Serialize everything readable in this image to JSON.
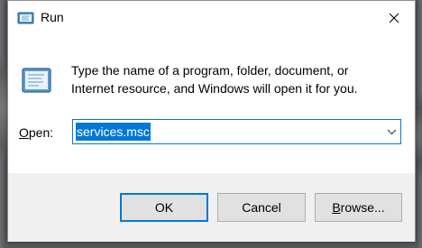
{
  "window": {
    "title": "Run",
    "title_icon": "run-icon",
    "close_icon": "close-icon"
  },
  "prompt": {
    "icon": "run-icon",
    "line1": "Type the name of a program, folder, document, or",
    "line2": "Internet resource, and Windows will open it for you."
  },
  "open": {
    "label_accel": "O",
    "label_rest": "pen:",
    "value": "services.msc",
    "dropdown_icon": "chevron-down-icon"
  },
  "buttons": {
    "ok": "OK",
    "cancel": "Cancel",
    "browse_accel": "B",
    "browse_rest": "rowse..."
  },
  "colors": {
    "accent": "#0078d7",
    "footer_bg": "#f0f0f0",
    "button_bg": "#e1e1e1"
  }
}
